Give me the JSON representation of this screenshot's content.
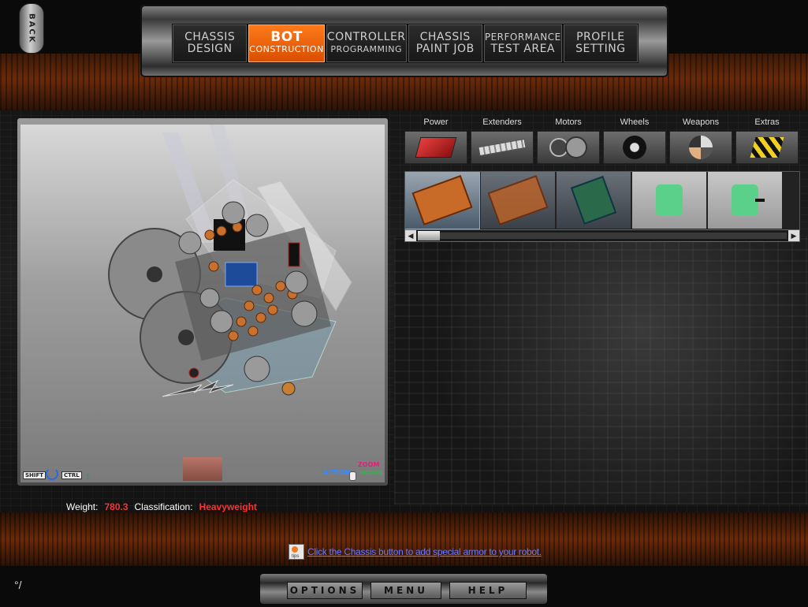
{
  "back_button": {
    "label": "BACK"
  },
  "nav_tabs": [
    {
      "line1": "CHASSIS",
      "line2": "DESIGN",
      "active": false
    },
    {
      "line1": "BOT",
      "line2": "CONSTRUCTION",
      "active": true
    },
    {
      "line1": "CONTROLLER",
      "line2": "PROGRAMMING",
      "active": false
    },
    {
      "line1": "CHASSIS",
      "line2": "PAINT JOB",
      "active": false
    },
    {
      "line1": "PERFORMANCE",
      "line2": "TEST AREA",
      "active": false
    },
    {
      "line1": "PROFILE",
      "line2": "SETTING",
      "active": false
    }
  ],
  "viewport": {
    "hints": {
      "shift": "SHIFT",
      "ctrl": "CTRL",
      "action": "ACTION",
      "zoom": "ZOOM",
      "rotate": "ROTATE"
    }
  },
  "categories": [
    {
      "label": "Power",
      "icon": "battery-icon"
    },
    {
      "label": "Extenders",
      "icon": "extender-bar-icon"
    },
    {
      "label": "Motors",
      "icon": "motor-icon"
    },
    {
      "label": "Wheels",
      "icon": "wheel-icon"
    },
    {
      "label": "Weapons",
      "icon": "weapon-icon"
    },
    {
      "label": "Extras",
      "icon": "hazard-stripes-icon"
    }
  ],
  "parts": [
    {
      "icon": "circuit-board-orange-icon",
      "selected": true
    },
    {
      "icon": "circuit-board-orange-icon",
      "selected": false
    },
    {
      "icon": "circuit-board-green-icon",
      "selected": false
    },
    {
      "icon": "green-block-icon",
      "selected": false
    },
    {
      "icon": "green-block-icon",
      "selected": false
    }
  ],
  "stats": {
    "weight_label": "Weight:",
    "weight_value": "780.3",
    "class_label": "Classification:",
    "class_value": "Heavyweight"
  },
  "tip": {
    "icon_text": "tips",
    "text": "Click the Chassis button to add special armor to your robot."
  },
  "bottom_menu": {
    "options": "OPTIONS",
    "menu": "MENU",
    "help": "HELP"
  },
  "colors": {
    "accent": "#e8640a",
    "value_red": "#ff3030",
    "tip_blue": "#6a7aff"
  }
}
